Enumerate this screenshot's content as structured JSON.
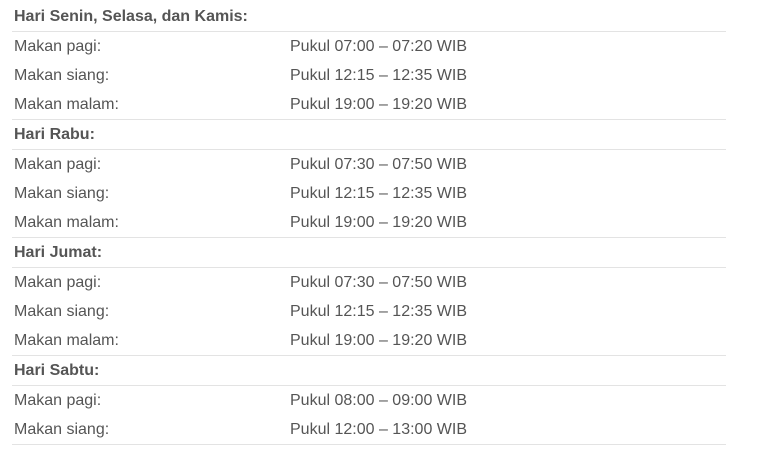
{
  "sections": [
    {
      "title": "Hari Senin, Selasa, dan Kamis:",
      "rows": [
        {
          "meal": "Makan pagi:",
          "time": "Pukul 07:00 – 07:20 WIB"
        },
        {
          "meal": "Makan siang:",
          "time": "Pukul 12:15 – 12:35 WIB"
        },
        {
          "meal": "Makan malam:",
          "time": "Pukul 19:00 – 19:20 WIB"
        }
      ]
    },
    {
      "title": "Hari Rabu:",
      "rows": [
        {
          "meal": "Makan pagi:",
          "time": "Pukul 07:30 – 07:50 WIB"
        },
        {
          "meal": "Makan siang:",
          "time": "Pukul 12:15 – 12:35 WIB"
        },
        {
          "meal": "Makan malam:",
          "time": "Pukul 19:00 – 19:20 WIB"
        }
      ]
    },
    {
      "title": "Hari Jumat:",
      "rows": [
        {
          "meal": "Makan pagi:",
          "time": "Pukul 07:30 – 07:50 WIB"
        },
        {
          "meal": "Makan siang:",
          "time": "Pukul 12:15 – 12:35 WIB"
        },
        {
          "meal": "Makan malam:",
          "time": "Pukul 19:00 – 19:20 WIB"
        }
      ]
    },
    {
      "title": "Hari Sabtu:",
      "rows": [
        {
          "meal": "Makan pagi:",
          "time": "Pukul 08:00 – 09:00 WIB"
        },
        {
          "meal": "Makan siang:",
          "time": "Pukul 12:00 – 13:00 WIB"
        }
      ]
    }
  ]
}
